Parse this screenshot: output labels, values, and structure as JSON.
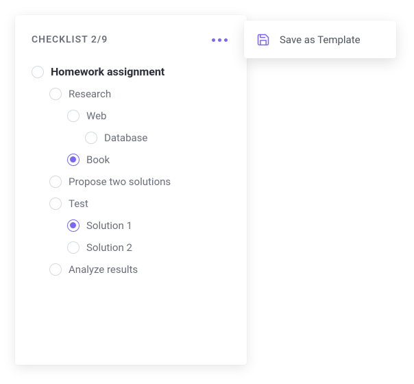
{
  "header": {
    "title": "CHECKLIST 2/9"
  },
  "menu": {
    "save_template_label": "Save as Template"
  },
  "accent": "#7b68ee",
  "items": [
    {
      "label": "Homework assignment",
      "checked": false,
      "root": true,
      "children": [
        {
          "label": "Research",
          "checked": false,
          "children": [
            {
              "label": "Web",
              "checked": false,
              "children": [
                {
                  "label": "Database",
                  "checked": false,
                  "children": []
                }
              ]
            },
            {
              "label": "Book",
              "checked": true,
              "children": []
            }
          ]
        },
        {
          "label": "Propose two solutions",
          "checked": false,
          "children": []
        },
        {
          "label": "Test",
          "checked": false,
          "children": [
            {
              "label": "Solution 1",
              "checked": true,
              "children": []
            },
            {
              "label": "Solution 2",
              "checked": false,
              "children": []
            }
          ]
        },
        {
          "label": "Analyze results",
          "checked": false,
          "children": []
        }
      ]
    }
  ]
}
